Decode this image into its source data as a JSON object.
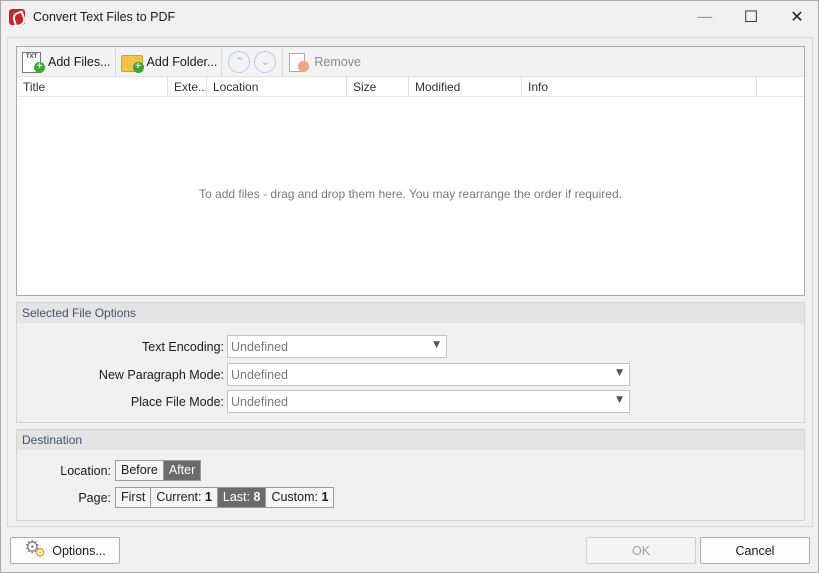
{
  "window": {
    "title": "Convert Text Files to PDF",
    "minimize_glyph": "—",
    "maximize_glyph": "☐",
    "close_glyph": "✕"
  },
  "toolbar": {
    "add_files_label": "Add Files...",
    "add_folder_label": "Add Folder...",
    "move_up_glyph": "⌃",
    "move_down_glyph": "⌄",
    "remove_label": "Remove",
    "icons": [
      "add-files-icon",
      "add-folder-icon",
      "move-up-icon",
      "move-down-icon",
      "remove-icon"
    ]
  },
  "file_list": {
    "columns": [
      "Title",
      "Exte...",
      "Location",
      "Size",
      "Modified",
      "Info"
    ],
    "empty_hint": "To add files - drag and drop them here. You may rearrange the order if required."
  },
  "selected_file_options": {
    "title": "Selected File Options",
    "text_encoding_label": "Text Encoding:",
    "text_encoding_value": "Undefined",
    "new_paragraph_label": "New Paragraph Mode:",
    "new_paragraph_value": "Undefined",
    "place_file_label": "Place File Mode:",
    "place_file_value": "Undefined"
  },
  "destination": {
    "title": "Destination",
    "location_label": "Location:",
    "location_options": [
      "Before",
      "After"
    ],
    "location_selected": "After",
    "page_label": "Page:",
    "page_first": "First",
    "page_current_label": "Current:",
    "page_current_value": "1",
    "page_last_label": "Last:",
    "page_last_value": "8",
    "page_custom_label": "Custom:",
    "page_custom_value": "1",
    "page_selected": "Last"
  },
  "footer": {
    "options_label": "Options...",
    "ok_label": "OK",
    "cancel_label": "Cancel"
  },
  "colors": {
    "accent_segment": "#6b6b6b",
    "group_title_text": "#41546e",
    "app_icon_red": "#d1221f"
  }
}
